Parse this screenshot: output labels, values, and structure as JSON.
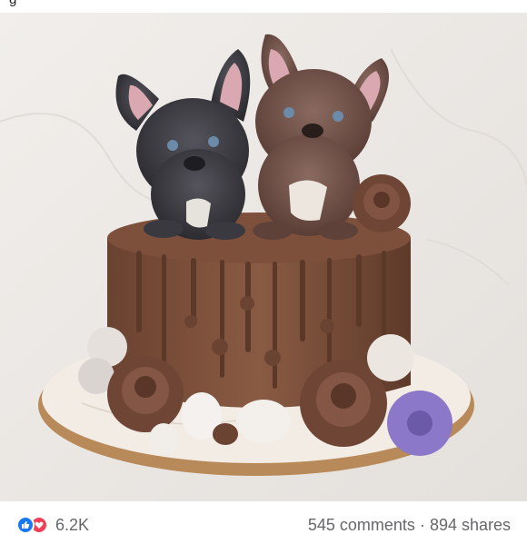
{
  "post": {
    "top_text_fragment": "g"
  },
  "photo": {
    "subject": "Chocolate cake with two French bulldog puppy toppers and fondant roses",
    "colors": {
      "background": "#ece9e6",
      "chocolate": "#7a4f3a",
      "chocolate_dark": "#5c3829",
      "board": "#f2ece4",
      "board_edge": "#b88a5a",
      "puppy_black": "#3b3a40",
      "puppy_brown": "#6e5047",
      "flower_purple": "#8c78c8"
    }
  },
  "footer": {
    "reaction_count": "6.2K",
    "comments": "545 comments",
    "shares": "894 shares",
    "icons": [
      "like-icon",
      "love-icon"
    ],
    "colors": {
      "like": "#1877f2",
      "love": "#f33e58",
      "text": "#65676b"
    }
  }
}
